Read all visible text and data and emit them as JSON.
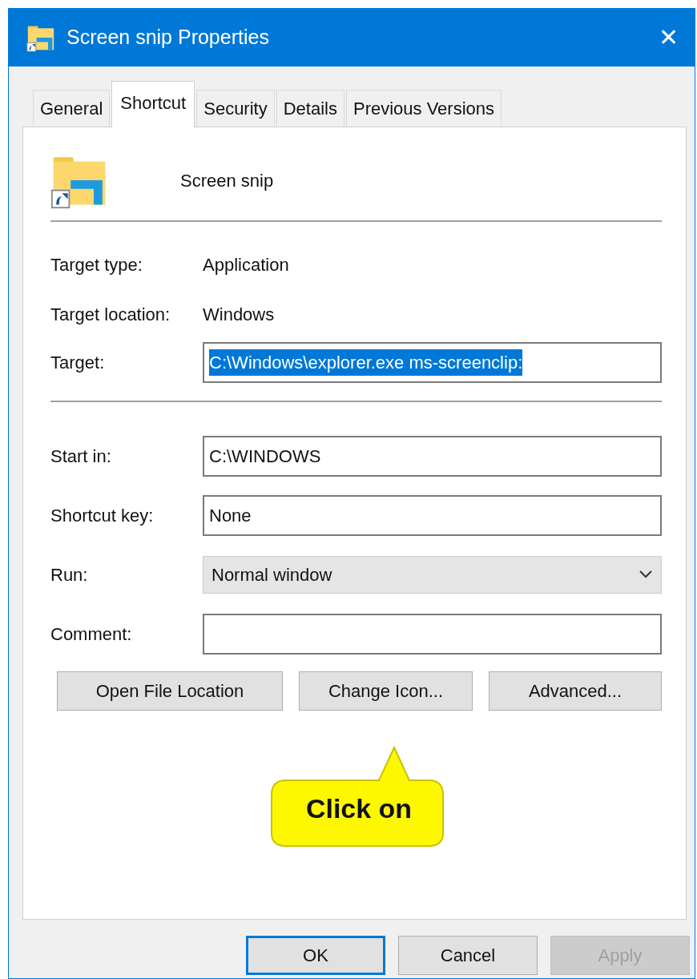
{
  "window": {
    "title": "Screen snip Properties",
    "close": "✕"
  },
  "tabs": [
    {
      "label": "General",
      "selected": false
    },
    {
      "label": "Shortcut",
      "selected": true
    },
    {
      "label": "Security",
      "selected": false
    },
    {
      "label": "Details",
      "selected": false
    },
    {
      "label": "Previous Versions",
      "selected": false
    }
  ],
  "shortcut": {
    "name": "Screen snip"
  },
  "properties": [
    {
      "label": "Target type:",
      "value": "Application"
    },
    {
      "label": "Target location:",
      "value": "Windows"
    }
  ],
  "target": {
    "label": "Target:",
    "value": "C:\\Windows\\explorer.exe ms-screenclip:",
    "text_selected": true
  },
  "fields": [
    {
      "label": "Start in:",
      "kind": "text",
      "value": "C:\\WINDOWS"
    },
    {
      "label": "Shortcut key:",
      "kind": "text",
      "value": "None"
    },
    {
      "label": "Run:",
      "kind": "select",
      "value": "Normal window"
    },
    {
      "label": "Comment:",
      "kind": "text"
    }
  ],
  "action_buttons": [
    "Open File Location",
    "Change Icon...",
    "Advanced..."
  ],
  "callout": {
    "text": "Click on"
  },
  "dialog_buttons": [
    {
      "label": "OK",
      "default": true,
      "disabled": false
    },
    {
      "label": "Cancel",
      "default": false,
      "disabled": false
    },
    {
      "label": "Apply",
      "default": false,
      "disabled": true
    }
  ]
}
